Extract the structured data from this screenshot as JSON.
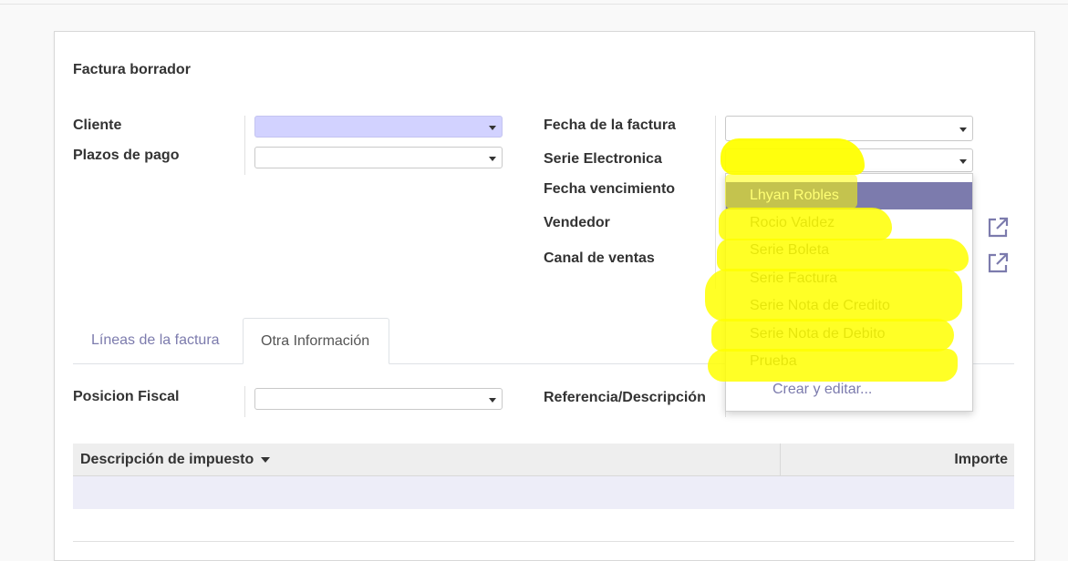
{
  "form": {
    "title": "Factura borrador",
    "labels": {
      "cliente": "Cliente",
      "plazos_pago": "Plazos de pago",
      "fecha_factura": "Fecha de la factura",
      "serie_electronica": "Serie Electronica",
      "fecha_vencimiento": "Fecha vencimiento",
      "vendedor": "Vendedor",
      "canal_ventas": "Canal de ventas",
      "posicion_fiscal": "Posicion Fiscal",
      "referencia": "Referencia/Descripción"
    }
  },
  "tabs": [
    {
      "label": "Líneas de la factura",
      "active": false
    },
    {
      "label": "Otra Información",
      "active": true
    }
  ],
  "tax_table": {
    "columns": [
      "Descripción de impuesto",
      "Importe"
    ]
  },
  "dropdown": {
    "options": [
      "Lhyan Robles",
      "Rocio Valdez",
      "Serie Boleta",
      "Serie Factura",
      "Serie Nota de Credito",
      "Serie Nota de Debito",
      "Prueba"
    ],
    "active_index": 0,
    "create_edit": "Crear y editar..."
  },
  "icons": {
    "external_link": "external-link-icon",
    "select_caret": "chevron-down-icon"
  },
  "colors": {
    "accent": "#7c7bad",
    "required_field": "#d2d2ff",
    "highlight": "#ffff00"
  }
}
